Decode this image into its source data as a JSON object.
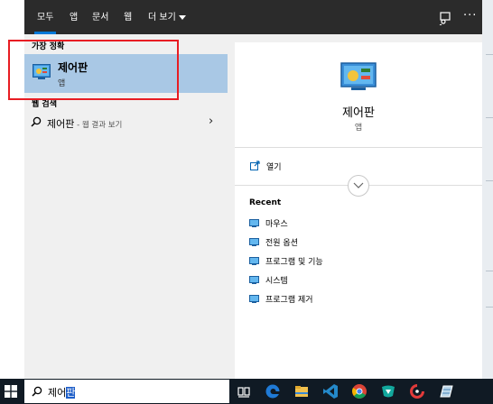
{
  "topbar": {
    "tabs": [
      {
        "label": "모두",
        "active": true
      },
      {
        "label": "앱"
      },
      {
        "label": "문서"
      },
      {
        "label": "웹"
      },
      {
        "label": "더 보기"
      }
    ],
    "icons": [
      "feedback-icon",
      "more-options-icon"
    ]
  },
  "left": {
    "best_match_label": "가장 정확",
    "best_match": {
      "title": "제어판",
      "subtitle": "앱",
      "icon": "control-panel-icon"
    },
    "web_section_label": "웹 검색",
    "web_result": {
      "query": "제어판",
      "suffix": " - 웹 결과 보기"
    }
  },
  "preview": {
    "title": "제어판",
    "subtitle": "앱",
    "open_label": "열기",
    "recent_heading": "Recent",
    "recent_items": [
      "마우스",
      "전원 옵션",
      "프로그램 및 기능",
      "시스템",
      "프로그램 제거"
    ]
  },
  "taskbar": {
    "search_typed": "제어",
    "search_selected": "판",
    "apps": [
      "task-view",
      "edge",
      "file-explorer",
      "vscode",
      "chrome",
      "app-green",
      "app-red-ring",
      "app-blue"
    ]
  },
  "colors": {
    "topbar_bg": "#2b2b2b",
    "accent": "#0078d7",
    "selection": "#a9c8e5",
    "highlight_box": "#e81d23",
    "taskbar_bg": "#101a24"
  }
}
